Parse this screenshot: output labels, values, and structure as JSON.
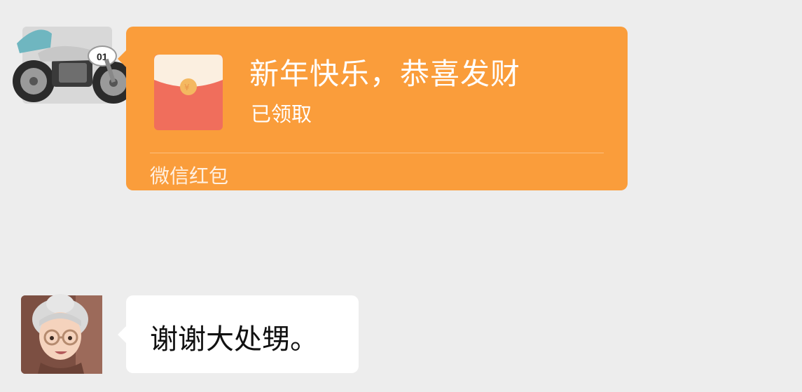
{
  "colors": {
    "background": "#EDEDED",
    "red_packet": "#FA9D3B",
    "bubble": "#FFFFFF",
    "text": "#111111"
  },
  "messages": [
    {
      "type": "red-packet",
      "avatar_icon": "motorcycle-avatar",
      "title": "新年快乐，恭喜发财",
      "status": "已领取",
      "footer": "微信红包"
    },
    {
      "type": "text",
      "avatar_icon": "grandma-memoji-avatar",
      "text": "谢谢大处甥。"
    }
  ]
}
